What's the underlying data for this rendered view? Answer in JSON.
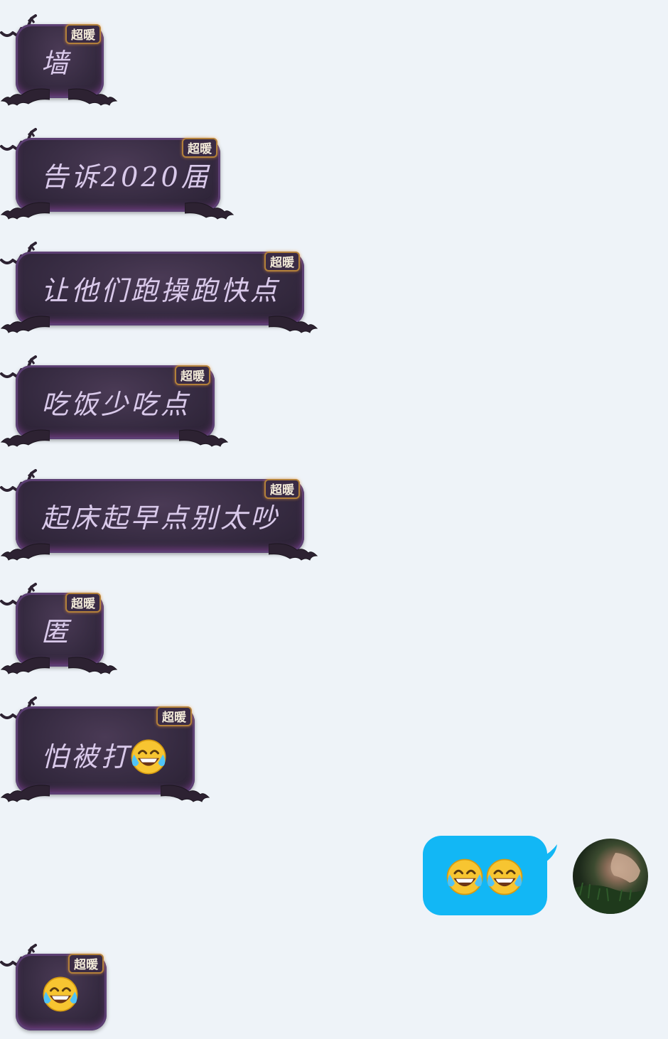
{
  "badge_label": "超暖",
  "messages": [
    {
      "text": "墙",
      "emoji": ""
    },
    {
      "text": "告诉2020届",
      "emoji": ""
    },
    {
      "text": "让他们跑操跑快点",
      "emoji": ""
    },
    {
      "text": "吃饭少吃点",
      "emoji": ""
    },
    {
      "text": "起床起早点别太吵",
      "emoji": ""
    },
    {
      "text": "匿",
      "emoji": ""
    },
    {
      "text": "怕被打",
      "emoji": "tears-of-joy-icon"
    }
  ],
  "outgoing": {
    "emojis": [
      "tears-of-joy-icon",
      "tears-of-joy-icon"
    ],
    "bubble_color": "#12b7f5"
  },
  "last_incoming": {
    "emoji": "tears-of-joy-icon"
  },
  "colors": {
    "background": "#eef3f8",
    "incoming_bubble": "#352a40",
    "incoming_text": "#d9c9ea",
    "badge_border": "#b2803a"
  }
}
